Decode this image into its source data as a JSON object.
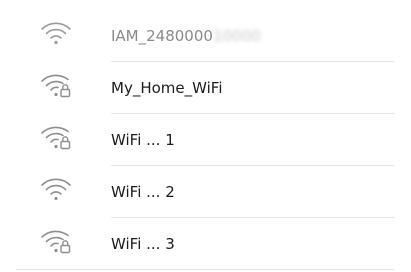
{
  "networks": [
    {
      "ssid": "IAM_2480000",
      "ssid_masked_tail": "10000",
      "secured": false,
      "icon": "wifi-signal-icon"
    },
    {
      "ssid": "My_Home_WiFi",
      "secured": true,
      "icon": "wifi-secured-icon"
    },
    {
      "ssid": "WiFi ... 1",
      "secured": true,
      "icon": "wifi-secured-icon"
    },
    {
      "ssid": "WiFi ... 2",
      "secured": false,
      "icon": "wifi-signal-icon"
    },
    {
      "ssid": "WiFi ... 3",
      "secured": true,
      "icon": "wifi-secured-icon"
    }
  ],
  "colors": {
    "icon": "#8e8e8e",
    "text": "#1c1c1c",
    "muted_text": "#8a8a8a",
    "separator": "#e6e6e6"
  }
}
